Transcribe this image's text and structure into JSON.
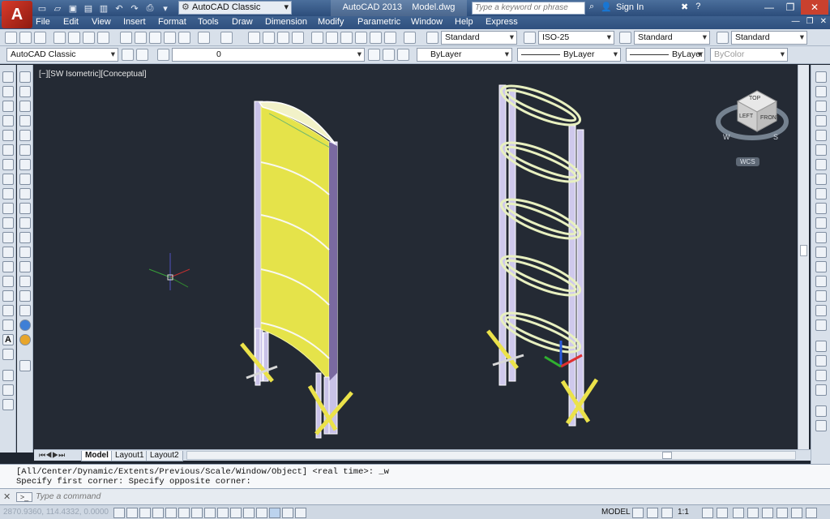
{
  "app": {
    "title": "AutoCAD 2013",
    "document": "Model.dwg",
    "logo_letter": "A",
    "workspace": "AutoCAD Classic",
    "search_placeholder": "Type a keyword or phrase",
    "sign_in": "Sign In"
  },
  "menus": [
    "File",
    "Edit",
    "View",
    "Insert",
    "Format",
    "Tools",
    "Draw",
    "Dimension",
    "Modify",
    "Parametric",
    "Window",
    "Help",
    "Express"
  ],
  "styles_toolbar": {
    "text_style": "Standard",
    "dim_style": "ISO-25",
    "table_style": "Standard",
    "multileader_style": "Standard"
  },
  "layers_toolbar": {
    "workspace": "AutoCAD Classic",
    "layer": "0",
    "color": "ByLayer",
    "linetype": "ByLayer",
    "lineweight": "ByLayer",
    "plotstyle": "ByColor"
  },
  "viewport": {
    "label": "[−][SW Isometric][Conceptual]",
    "wcs_label": "WCS",
    "viewcube": {
      "top": "TOP",
      "left": "LEFT",
      "front": "FRONT",
      "west": "W",
      "south": "S"
    },
    "accent_colors": {
      "panel_fill": "#e5e34a",
      "frame": "#e8f0c0",
      "background": "#242a34"
    }
  },
  "layout_tabs": [
    "Model",
    "Layout1",
    "Layout2"
  ],
  "command": {
    "history": [
      "[All/Center/Dynamic/Extents/Previous/Scale/Window/Object] <real time>: _w",
      "Specify first corner: Specify opposite corner:"
    ],
    "placeholder": "Type a command"
  },
  "status": {
    "coordinates": "2870.9360, 114.4332, 0.0000",
    "space": "MODEL",
    "annotation_scale": "1:1"
  }
}
